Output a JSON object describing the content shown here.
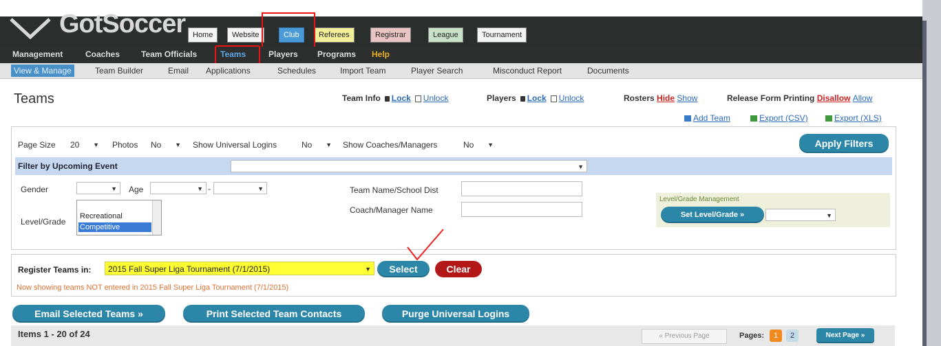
{
  "logo": "GotSoccer",
  "main_tabs": [
    "Home",
    "Website",
    "Club",
    "Referees",
    "Registrar",
    "League",
    "Tournament"
  ],
  "nav2": [
    "Management",
    "Coaches",
    "Team Officials",
    "Teams",
    "Players",
    "Programs",
    "Help"
  ],
  "nav3": [
    "View & Manage",
    "Team Builder",
    "Email",
    "Applications",
    "Schedules",
    "Import Team",
    "Player Search",
    "Misconduct Report",
    "Documents"
  ],
  "page_title": "Teams",
  "info": {
    "team_info": "Team Info",
    "players": "Players",
    "lock": "Lock",
    "unlock": "Unlock",
    "rosters": "Rosters",
    "hide": "Hide",
    "show": "Show",
    "release": "Release Form Printing",
    "disallow": "Disallow",
    "allow": "Allow"
  },
  "exports": {
    "add_team": "Add Team",
    "export_csv": "Export (CSV)",
    "export_xls": "Export (XLS)"
  },
  "filters": {
    "page_size_label": "Page Size",
    "page_size": "20",
    "photos_label": "Photos",
    "photos": "No",
    "universal_label": "Show Universal Logins",
    "universal": "No",
    "coaches_label": "Show Coaches/Managers",
    "coaches": "No",
    "apply": "Apply Filters",
    "upcoming": "Filter by Upcoming Event",
    "gender": "Gender",
    "age": "Age",
    "dash": "-",
    "level_grade": "Level/Grade",
    "level_options": [
      "Recreational",
      "Competitive"
    ],
    "team_name": "Team Name/School Dist",
    "coach_name": "Coach/Manager Name",
    "level_mgmt_title": "Level/Grade Management",
    "set_level": "Set Level/Grade »"
  },
  "register": {
    "label": "Register Teams in:",
    "tournament": "2015 Fall Super Liga Tournament (7/1/2015)",
    "select": "Select",
    "clear": "Clear",
    "notice": "Now showing teams NOT entered in 2015 Fall Super Liga Tournament (7/1/2015)"
  },
  "actions": {
    "email": "Email Selected Teams »",
    "print": "Print Selected Team Contacts",
    "purge": "Purge Universal Logins"
  },
  "pager": {
    "items": "Items 1 - 20 of 24",
    "prev": "« Previous Page",
    "pages_label": "Pages:",
    "page1": "1",
    "page2": "2",
    "next": "Next Page »"
  },
  "colors": {
    "teal": "#2c86a8",
    "red": "#b21818",
    "highlight": "#ffff33",
    "nav_dark": "#2c2f2d",
    "filter_bar": "#c6d8f0"
  }
}
